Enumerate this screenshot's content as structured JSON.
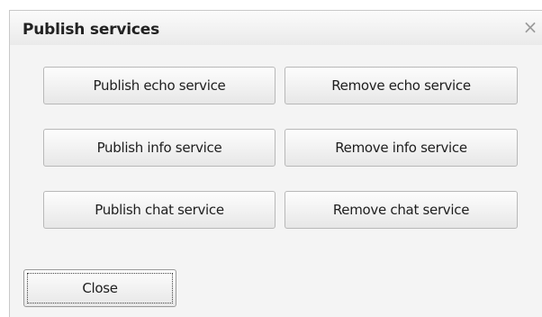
{
  "dialog": {
    "title": "Publish services",
    "close_icon": "close-icon"
  },
  "services": {
    "publish_echo": "Publish echo service",
    "remove_echo": "Remove echo service",
    "publish_info": "Publish info service",
    "remove_info": "Remove info service",
    "publish_chat": "Publish chat service",
    "remove_chat": "Remove chat service"
  },
  "footer": {
    "close_label": "Close"
  }
}
